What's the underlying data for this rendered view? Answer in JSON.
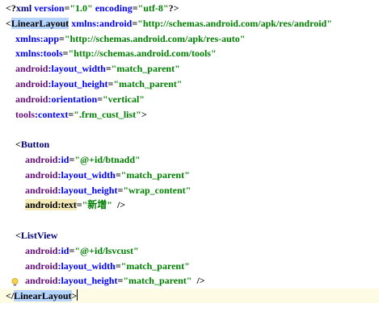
{
  "colors": {
    "punct": "#000000",
    "tag": "#000080",
    "attr": "#0000ff",
    "ns": "#660e7a",
    "value": "#008000",
    "tag_highlight": "#b5d5ff",
    "attr_highlight": "#f5ebb8",
    "current_line": "#fdfbe3"
  },
  "gutter_icon": "lightbulb-icon",
  "lines": [
    {
      "tokens": [
        [
          "punct",
          "<?"
        ],
        [
          "tag",
          "xml "
        ],
        [
          "attr",
          "version"
        ],
        [
          "punct",
          "="
        ],
        [
          "val",
          "\"1.0\""
        ],
        [
          "punct",
          " "
        ],
        [
          "attr",
          "encoding"
        ],
        [
          "punct",
          "="
        ],
        [
          "val",
          "\"utf-8\""
        ],
        [
          "punct",
          "?>"
        ]
      ]
    },
    {
      "tokens": [
        [
          "punct",
          "<"
        ],
        [
          "tag-hl",
          "LinearLayout"
        ],
        [
          "punct",
          " "
        ],
        [
          "attr",
          "xmlns:android"
        ],
        [
          "punct",
          "="
        ],
        [
          "val",
          "\"http://schemas.android.com/apk/res/android\""
        ]
      ]
    },
    {
      "tokens": [
        [
          "punct",
          "    "
        ],
        [
          "attr",
          "xmlns:app"
        ],
        [
          "punct",
          "="
        ],
        [
          "val",
          "\"http://schemas.android.com/apk/res-auto\""
        ]
      ]
    },
    {
      "tokens": [
        [
          "punct",
          "    "
        ],
        [
          "attr",
          "xmlns:tools"
        ],
        [
          "punct",
          "="
        ],
        [
          "val",
          "\"http://schemas.android.com/tools\""
        ]
      ]
    },
    {
      "tokens": [
        [
          "punct",
          "    "
        ],
        [
          "ns",
          "android"
        ],
        [
          "attr",
          ":layout_width"
        ],
        [
          "punct",
          "="
        ],
        [
          "val",
          "\"match_parent\""
        ]
      ]
    },
    {
      "tokens": [
        [
          "punct",
          "    "
        ],
        [
          "ns",
          "android"
        ],
        [
          "attr",
          ":layout_height"
        ],
        [
          "punct",
          "="
        ],
        [
          "val",
          "\"match_parent\""
        ]
      ]
    },
    {
      "tokens": [
        [
          "punct",
          "    "
        ],
        [
          "ns",
          "android"
        ],
        [
          "attr",
          ":orientation"
        ],
        [
          "punct",
          "="
        ],
        [
          "val",
          "\"vertical\""
        ]
      ]
    },
    {
      "tokens": [
        [
          "punct",
          "    "
        ],
        [
          "ns",
          "tools"
        ],
        [
          "attr",
          ":context"
        ],
        [
          "punct",
          "="
        ],
        [
          "val",
          "\".frm_cust_list\""
        ],
        [
          "punct",
          ">"
        ]
      ]
    },
    {
      "tokens": []
    },
    {
      "tokens": [
        [
          "punct",
          "    <"
        ],
        [
          "tag",
          "Button"
        ]
      ]
    },
    {
      "tokens": [
        [
          "punct",
          "        "
        ],
        [
          "ns",
          "android"
        ],
        [
          "attr",
          ":id"
        ],
        [
          "punct",
          "="
        ],
        [
          "val",
          "\"@+id/btnadd\""
        ]
      ]
    },
    {
      "tokens": [
        [
          "punct",
          "        "
        ],
        [
          "ns",
          "android"
        ],
        [
          "attr",
          ":layout_width"
        ],
        [
          "punct",
          "="
        ],
        [
          "val",
          "\"match_parent\""
        ]
      ]
    },
    {
      "tokens": [
        [
          "punct",
          "        "
        ],
        [
          "ns",
          "android"
        ],
        [
          "attr",
          ":layout_height"
        ],
        [
          "punct",
          "="
        ],
        [
          "val",
          "\"wrap_content\""
        ]
      ]
    },
    {
      "tokens": [
        [
          "punct",
          "        "
        ],
        [
          "attr-hl",
          "android:text"
        ],
        [
          "punct",
          "="
        ],
        [
          "val",
          "\"新增\""
        ],
        [
          "punct",
          "  />"
        ]
      ]
    },
    {
      "tokens": []
    },
    {
      "tokens": [
        [
          "punct",
          "    <"
        ],
        [
          "tag",
          "ListView"
        ]
      ]
    },
    {
      "tokens": [
        [
          "punct",
          "        "
        ],
        [
          "ns",
          "android"
        ],
        [
          "attr",
          ":id"
        ],
        [
          "punct",
          "="
        ],
        [
          "val",
          "\"@+id/lsvcust\""
        ]
      ]
    },
    {
      "tokens": [
        [
          "punct",
          "        "
        ],
        [
          "ns",
          "android"
        ],
        [
          "attr",
          ":layout_width"
        ],
        [
          "punct",
          "="
        ],
        [
          "val",
          "\"match_parent\""
        ]
      ]
    },
    {
      "tokens": [
        [
          "punct",
          "        "
        ],
        [
          "ns",
          "android"
        ],
        [
          "attr",
          ":layout_height"
        ],
        [
          "punct",
          "="
        ],
        [
          "val",
          "\"match_parent\""
        ],
        [
          "punct",
          "  />"
        ]
      ]
    },
    {
      "tokens": [
        [
          "punct",
          "</"
        ],
        [
          "tag-hl",
          "LinearLayout"
        ],
        [
          "punct",
          ">"
        ]
      ],
      "current": true
    }
  ]
}
